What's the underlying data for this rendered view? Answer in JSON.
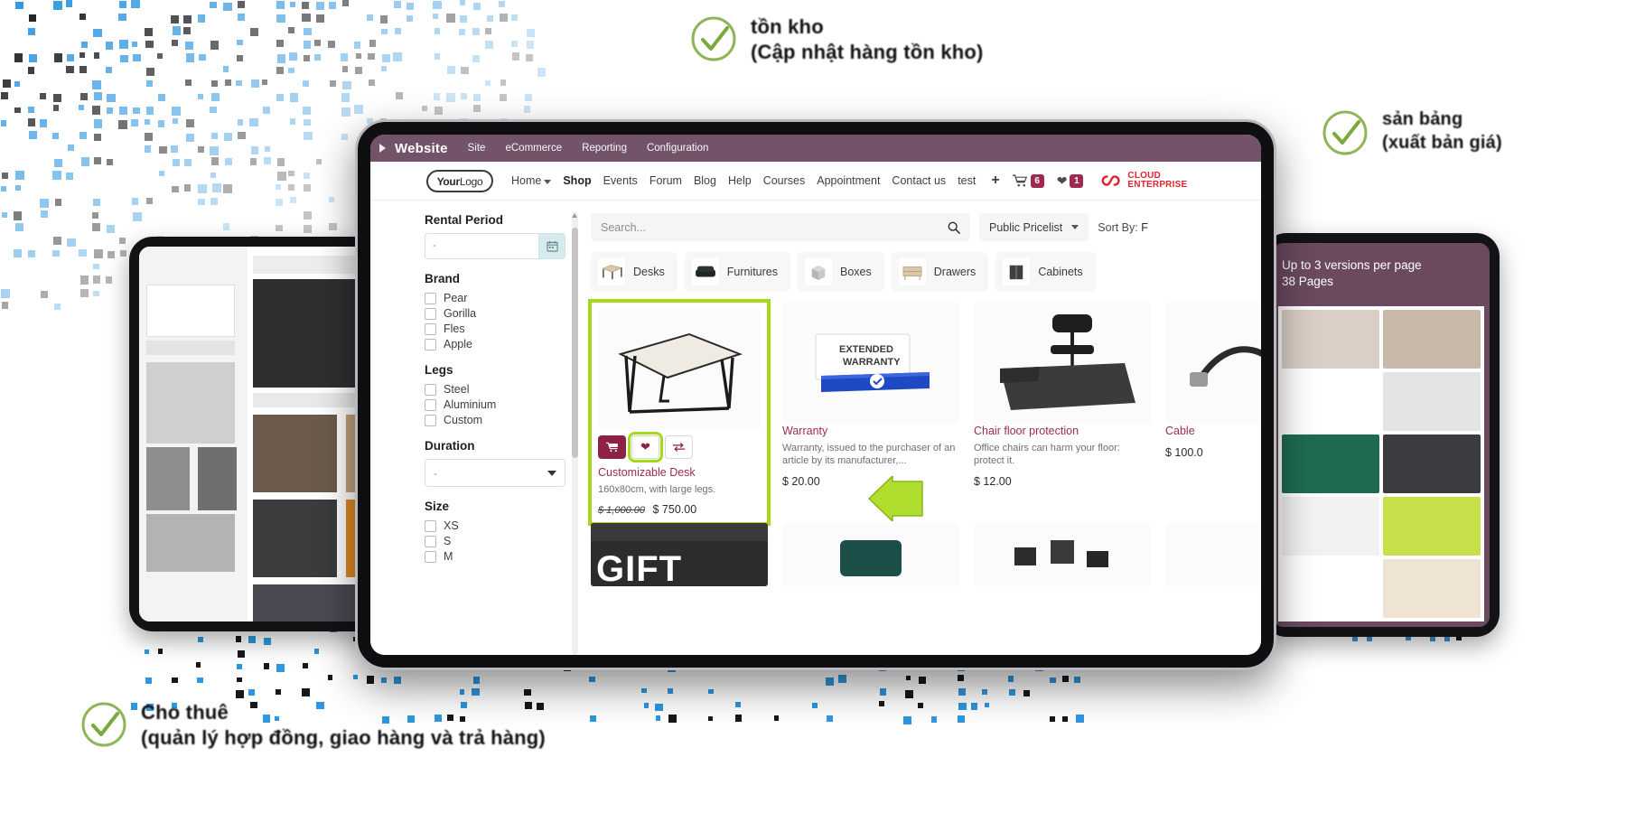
{
  "odoo_topbar": {
    "brand": "Website",
    "menus": [
      "Site",
      "eCommerce",
      "Reporting",
      "Configuration"
    ]
  },
  "site_header": {
    "logo": {
      "bold": "Your",
      "thin": "Logo"
    },
    "nav": [
      {
        "label": "Home",
        "has_caret": true,
        "active": false
      },
      {
        "label": "Shop",
        "has_caret": false,
        "active": true
      },
      {
        "label": "Events",
        "has_caret": false,
        "active": false
      },
      {
        "label": "Forum",
        "has_caret": false,
        "active": false
      },
      {
        "label": "Blog",
        "has_caret": false,
        "active": false
      },
      {
        "label": "Help",
        "has_caret": false,
        "active": false
      },
      {
        "label": "Courses",
        "has_caret": false,
        "active": false
      },
      {
        "label": "Appointment",
        "has_caret": false,
        "active": false
      },
      {
        "label": "Contact us",
        "has_caret": false,
        "active": false
      },
      {
        "label": "test",
        "has_caret": false,
        "active": false
      }
    ],
    "add_page_icon": "+",
    "cart_count": "6",
    "wishlist_count": "1",
    "partner_logo": {
      "line1": "CLOUD",
      "line2": "ENTERPRISE",
      "color": "#e0242c"
    }
  },
  "sidebar": {
    "groups": [
      {
        "title": "Rental Period",
        "type": "daterange",
        "value": "-",
        "icon": "calendar-icon"
      },
      {
        "title": "Brand",
        "type": "checkbox",
        "options": [
          "Pear",
          "Gorilla",
          "Fles",
          "Apple"
        ]
      },
      {
        "title": "Legs",
        "type": "checkbox",
        "options": [
          "Steel",
          "Aluminium",
          "Custom"
        ]
      },
      {
        "title": "Duration",
        "type": "select",
        "value": "-"
      },
      {
        "title": "Size",
        "type": "checkbox",
        "options": [
          "XS",
          "S",
          "M"
        ]
      }
    ]
  },
  "toolbar": {
    "search_placeholder": "Search...",
    "search_icon": "search-icon",
    "pricelist_label": "Public Pricelist",
    "sort_by_label": "Sort By:",
    "sort_by_value": "F"
  },
  "categories": [
    {
      "label": "Desks",
      "icon": "desk-icon"
    },
    {
      "label": "Furnitures",
      "icon": "sofa-icon"
    },
    {
      "label": "Boxes",
      "icon": "box-icon"
    },
    {
      "label": "Drawers",
      "icon": "drawer-icon"
    },
    {
      "label": "Cabinets",
      "icon": "cabinet-icon"
    }
  ],
  "products": [
    {
      "name": "Customizable Desk",
      "description": "160x80cm, with large legs.",
      "price_old": "$ 1,000.00",
      "price_new": "$ 750.00",
      "featured": true,
      "actions": {
        "cart": "cart-icon",
        "wishlist": "heart-icon",
        "compare": "compare-icon"
      }
    },
    {
      "name": "Warranty",
      "description": "Warranty, issued to the purchaser of an article by its manufacturer,...",
      "price_old": "",
      "price_new": "$ 20.00",
      "featured": false
    },
    {
      "name": "Chair floor protection",
      "description": "Office chairs can harm your floor: protect it.",
      "price_old": "",
      "price_new": "$ 12.00",
      "featured": false
    },
    {
      "name": "Cable",
      "description": "",
      "price_old": "",
      "price_new": "$ 100.0",
      "featured": false
    }
  ],
  "right_tablet": {
    "caption_line1": "Up to 3 versions per page",
    "caption_line2": "38 Pages"
  },
  "annotations": [
    {
      "id": "top",
      "icon": "check-circle-icon",
      "line1": "tồn kho",
      "line2": "(Cập nhật hàng tồn kho)"
    },
    {
      "id": "right",
      "icon": "check-circle-icon",
      "line1": "sản bảng",
      "line2": "(xuất bản giá)"
    },
    {
      "id": "bottom",
      "icon": "check-circle-icon",
      "line1": "Cho thuê",
      "line2": "(quản lý hợp đồng, giao hàng và trả hàng)"
    }
  ],
  "colors": {
    "odoo_purple": "#72536a",
    "brand_red": "#9e2a4f",
    "highlight_green": "#a4d916",
    "pattern_blue": "#2f97e0",
    "partner_red": "#e0242c"
  }
}
